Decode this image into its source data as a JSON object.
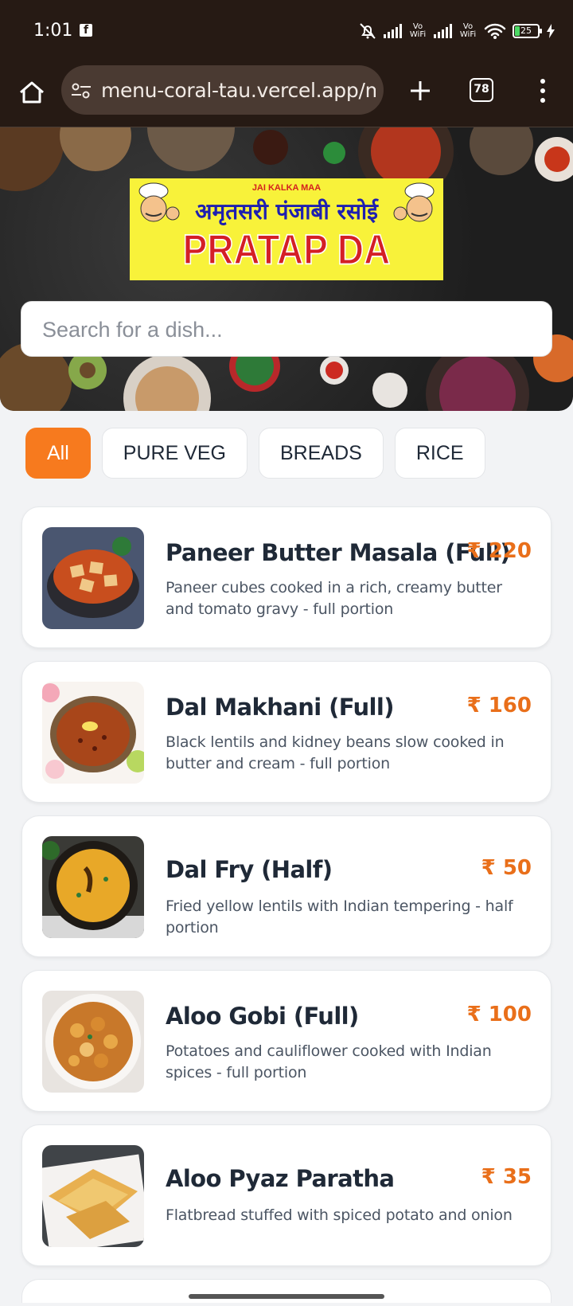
{
  "status_bar": {
    "time": "1:01",
    "notification_icon": "facebook-icon",
    "carrier_1": "Vo WiFi",
    "carrier_2": "Vo WiFi",
    "battery": "25"
  },
  "browser": {
    "url": "menu-coral-tau.vercel.app/m",
    "tab_count": "78"
  },
  "banner": {
    "top_line": "JAI KALKA MAA",
    "hindi_line": "अमृतसरी पंजाबी रसोई",
    "title": "PRATAP DA DHABA"
  },
  "search": {
    "placeholder": "Search for a dish..."
  },
  "filters": [
    {
      "label": "All",
      "active": true
    },
    {
      "label": "PURE VEG",
      "active": false
    },
    {
      "label": "BREADS",
      "active": false
    },
    {
      "label": "RICE",
      "active": false
    }
  ],
  "menu": [
    {
      "name": "Paneer Butter Masala (Full)",
      "price": "₹ 220",
      "description": "Paneer cubes cooked in a rich, creamy butter and tomato gravy - full portion"
    },
    {
      "name": "Dal Makhani (Full)",
      "price": "₹ 160",
      "description": "Black lentils and kidney beans slow cooked in butter and cream - full portion"
    },
    {
      "name": "Dal Fry (Half)",
      "price": "₹ 50",
      "description": "Fried yellow lentils with Indian tempering - half portion"
    },
    {
      "name": "Aloo Gobi (Full)",
      "price": "₹ 100",
      "description": "Potatoes and cauliflower cooked with Indian spices - full portion"
    },
    {
      "name": "Aloo Pyaz Paratha",
      "price": "₹ 35",
      "description": "Flatbread stuffed with spiced potato and onion"
    }
  ],
  "colors": {
    "accent": "#f77a1e",
    "price": "#e96f1a",
    "status_bar": "#261a14"
  }
}
